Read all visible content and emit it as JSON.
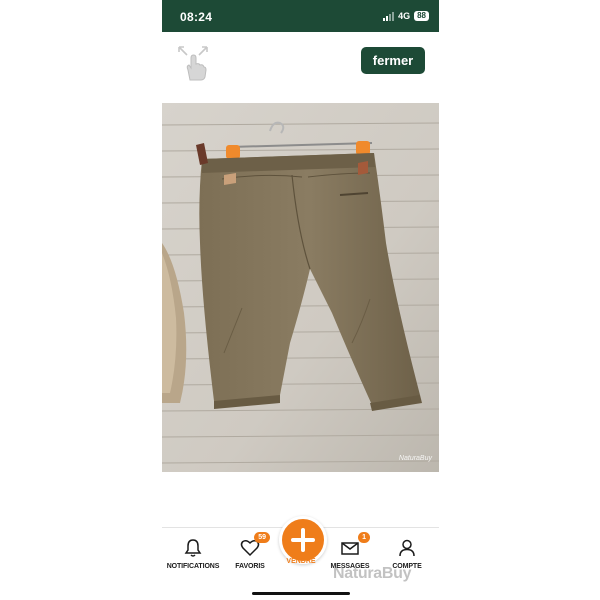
{
  "status_bar": {
    "time": "08:24",
    "network": "4G",
    "battery": "88"
  },
  "header": {
    "close_label": "fermer"
  },
  "photo": {
    "watermark": "NaturaBuy"
  },
  "bottom_nav": {
    "items": [
      {
        "label": "NOTIFICATIONS",
        "icon": "bell-icon"
      },
      {
        "label": "FAVORIS",
        "icon": "heart-icon",
        "badge": "59"
      },
      {
        "label": "VENDRE",
        "icon": "plus-icon"
      },
      {
        "label": "MESSAGES",
        "icon": "mail-icon",
        "badge": "1"
      },
      {
        "label": "COMPTE",
        "icon": "user-icon"
      }
    ],
    "brand_watermark": "NaturaBuy"
  },
  "colors": {
    "brand_green": "#1d4a36",
    "accent_orange": "#ef7d1a"
  }
}
